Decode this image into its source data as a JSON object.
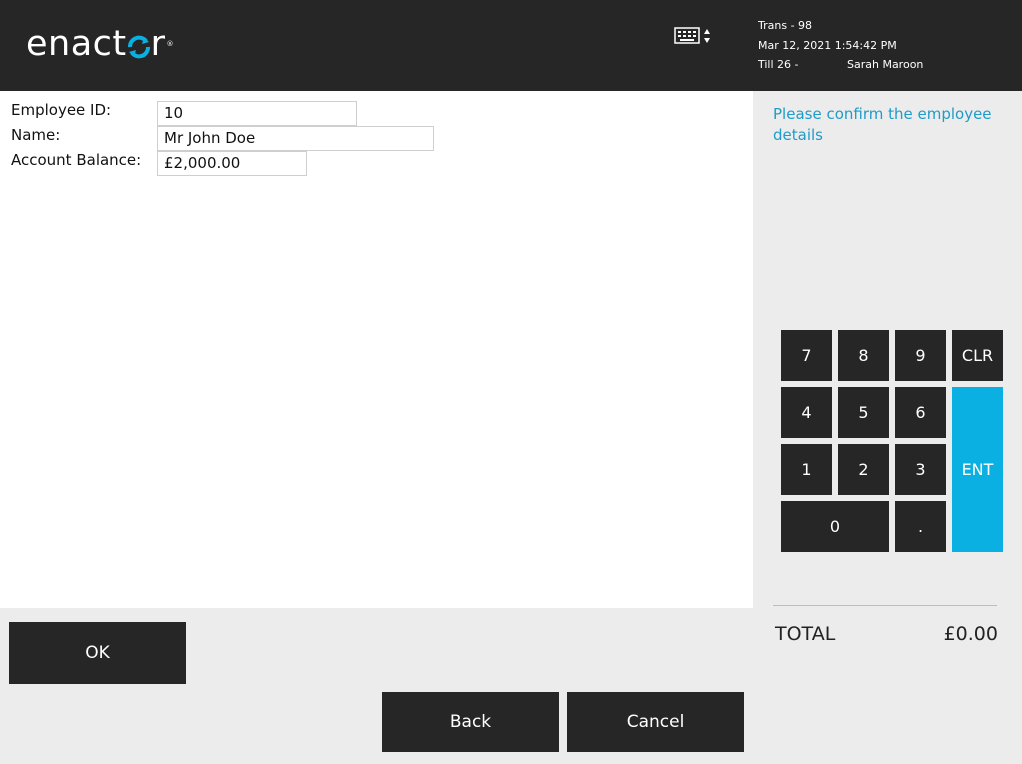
{
  "header": {
    "brand": {
      "left": "ena",
      "mid": "c",
      "right": "t",
      "swirl": "o",
      "end": "r",
      "tm": "®"
    },
    "keyboard_toggle_icon": "keyboard-icon",
    "trans": "Trans - 98",
    "datetime": "Mar 12, 2021 1:54:42 PM",
    "till": "Till 26 -",
    "operator": "Sarah Maroon"
  },
  "form": {
    "employee_id_label": "Employee ID:",
    "employee_id_value": "10",
    "name_label": "Name:",
    "name_value": "Mr John Doe",
    "balance_label": "Account Balance:",
    "balance_value": "£2,000.00"
  },
  "prompt": "Please confirm the employee details",
  "keypad": {
    "k7": "7",
    "k8": "8",
    "k9": "9",
    "clr": "CLR",
    "k4": "4",
    "k5": "5",
    "k6": "6",
    "k1": "1",
    "k2": "2",
    "k3": "3",
    "k0": "0",
    "dot": ".",
    "ent": "ENT"
  },
  "totals": {
    "label": "TOTAL",
    "value": "£0.00"
  },
  "buttons": {
    "ok": "OK",
    "back": "Back",
    "cancel": "Cancel"
  },
  "colors": {
    "header_bg": "#262626",
    "accent": "#0ab0e2",
    "prompt_text": "#1f9bc9",
    "button_bg": "#262626"
  }
}
